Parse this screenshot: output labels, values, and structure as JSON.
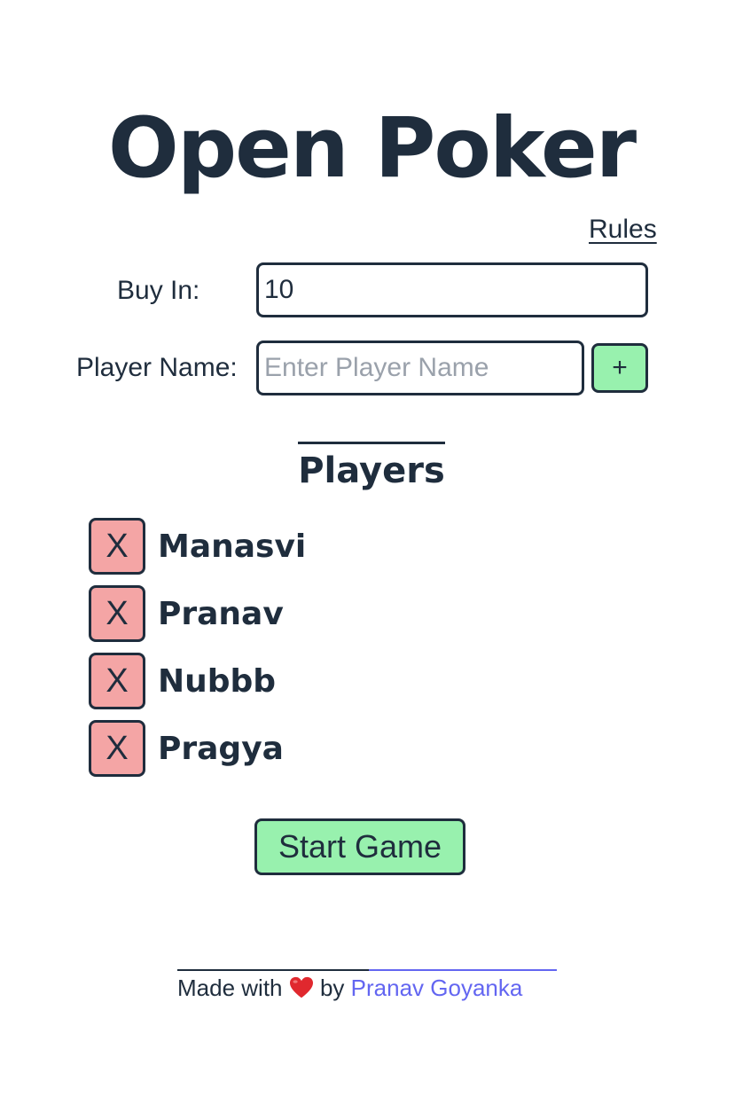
{
  "app": {
    "title": "Open Poker",
    "rules_link": "Rules"
  },
  "form": {
    "buy_in_label": "Buy In:",
    "buy_in_value": "10",
    "player_name_label": "Player Name:",
    "player_name_value": "",
    "player_name_placeholder": "Enter Player Name",
    "add_button_label": "+"
  },
  "players": {
    "heading": "Players",
    "remove_label": "X",
    "list": [
      {
        "name": "Manasvi"
      },
      {
        "name": "Pranav"
      },
      {
        "name": "Nubbb"
      },
      {
        "name": "Pragya"
      }
    ]
  },
  "actions": {
    "start_game_label": "Start Game"
  },
  "footer": {
    "made_with": "Made with",
    "by": "by",
    "heart_icon": "heart-icon",
    "author_name": "Pranav Goyanka"
  },
  "colors": {
    "text": "#1f2d3d",
    "add_button_bg": "#98f1ae",
    "remove_button_bg": "#f4a5a5",
    "link_accent": "#6366f1",
    "heart": "#e0282e"
  }
}
